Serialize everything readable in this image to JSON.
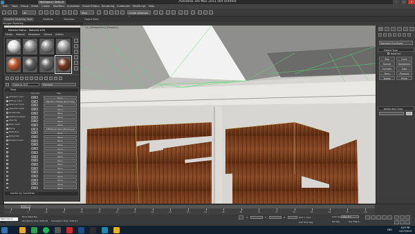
{
  "window": {
    "title": "Autodesk 3ds Max  2013 x64     Untitled",
    "workspace": "Workspace: Default",
    "controls": {
      "minimize": "–",
      "maximize": "□",
      "close": "✕"
    }
  },
  "menubar": [
    "Edit",
    "Tools",
    "Group",
    "Views",
    "Create",
    "Modifiers",
    "Animation",
    "Graph Editors",
    "Rendering",
    "Customize",
    "MAXScript",
    "Help"
  ],
  "toolbar": {
    "selection_filter": "All",
    "view_dropdown": "View",
    "selection_set": "Create Selection Se"
  },
  "ribbon": {
    "tabs": [
      "Graphite Modeling Tools",
      "Freeform",
      "Selection",
      "Object Paint"
    ],
    "sub": "Polygon Modeling"
  },
  "viewport": {
    "label": "[+] [Perspective] [Realistic]"
  },
  "material_editor": {
    "title": "Material Editor - Material #33",
    "menu": [
      "Modes",
      "Material",
      "Navigation",
      "Options",
      "Utilities"
    ],
    "slots": [
      {
        "name": "slot-1",
        "color": "#e5e5e5"
      },
      {
        "name": "slot-2",
        "color": "#9a9a9a"
      },
      {
        "name": "slot-3",
        "color": "#8c8c8c"
      },
      {
        "name": "slot-4",
        "color": "#aaaaaa"
      },
      {
        "name": "slot-5",
        "color": "#c05a2e"
      },
      {
        "name": "slot-6",
        "color": "#5d5d5d"
      },
      {
        "name": "slot-7",
        "color": "#6a6a6a"
      },
      {
        "name": "slot-8",
        "color": "#7a3a20"
      }
    ],
    "material_name": "Material #33",
    "map_type": "Standard",
    "maps_header": "Maps",
    "maps_columns": {
      "amount": "Amount",
      "map": "Map"
    },
    "maps": [
      {
        "label": "Ambient Color",
        "amount": "100",
        "map": "None",
        "on": false
      },
      {
        "label": "Diffuse Color",
        "amount": "100",
        "map": "Map #11 (images.jpg (1).jpg)",
        "on": true
      },
      {
        "label": "Specular Color",
        "amount": "100",
        "map": "None",
        "on": false
      },
      {
        "label": "Specular Level",
        "amount": "100",
        "map": "None",
        "on": false
      },
      {
        "label": "Glossiness",
        "amount": "100",
        "map": "None",
        "on": false
      },
      {
        "label": "Self-Illumination",
        "amount": "100",
        "map": "None",
        "on": false
      },
      {
        "label": "Opacity",
        "amount": "100",
        "map": "None",
        "on": false
      },
      {
        "label": "Filter Color",
        "amount": "100",
        "map": "None",
        "on": false
      },
      {
        "label": "Bump",
        "amount": "30",
        "map": "4788-Brown-Wood-Planks.jpg)",
        "on": true
      },
      {
        "label": "Reflection",
        "amount": "100",
        "map": "None",
        "on": false
      },
      {
        "label": "Refraction",
        "amount": "100",
        "map": "None",
        "on": false
      },
      {
        "label": "Displacement",
        "amount": "100",
        "map": "None",
        "on": false
      },
      {
        "label": "",
        "amount": "100",
        "map": "None",
        "on": false
      },
      {
        "label": "",
        "amount": "100",
        "map": "None",
        "on": false
      },
      {
        "label": "",
        "amount": "100",
        "map": "None",
        "on": false
      },
      {
        "label": "",
        "amount": "100",
        "map": "None",
        "on": false
      },
      {
        "label": "",
        "amount": "100",
        "map": "None",
        "on": false
      },
      {
        "label": "",
        "amount": "100",
        "map": "None",
        "on": false
      },
      {
        "label": "",
        "amount": "100",
        "map": "None",
        "on": false
      },
      {
        "label": "",
        "amount": "100",
        "map": "None",
        "on": false
      },
      {
        "label": "",
        "amount": "100",
        "map": "None",
        "on": false
      },
      {
        "label": "",
        "amount": "100",
        "map": "None",
        "on": false
      },
      {
        "label": "",
        "amount": "100",
        "map": "None",
        "on": false
      },
      {
        "label": "",
        "amount": "100",
        "map": "None",
        "on": false
      }
    ],
    "footer": "mental ray Connection"
  },
  "command_panel": {
    "category": "Standard Primitives",
    "object_type_title": "Object Type",
    "autogrid": "AutoGrid",
    "buttons": [
      "Box",
      "Cone",
      "Sphere",
      "GeoSphere",
      "Cylinder",
      "Tube",
      "Torus",
      "Pyramid",
      "Teapot",
      "Plane"
    ],
    "name_color_title": "Name and Color"
  },
  "timeline": {
    "slider": "0 / 100",
    "ticks": [
      "0",
      "5",
      "10",
      "15",
      "20",
      "25",
      "30",
      "35",
      "40",
      "45",
      "50",
      "55",
      "60",
      "65",
      "70",
      "75",
      "80",
      "85",
      "90",
      "95",
      "100"
    ]
  },
  "status": {
    "listener": "Welcome to MAX",
    "selection": "None Selected",
    "prompt": "Rendering Time: 0:00:26",
    "translation": "Translation Time: 0:00:01",
    "x_label": "X:",
    "y_label": "Y:",
    "z_label": "Z:",
    "grid": "Grid = 10.0",
    "autokey": "Auto Key",
    "selected": "Selected",
    "setkey": "Set Key",
    "keyfilters": "Key Filters...",
    "addtimetag": "Add Time Tag"
  },
  "taskbar": {
    "time": "6:29 PM",
    "date": "10/17/2015",
    "lang": "ENG"
  }
}
